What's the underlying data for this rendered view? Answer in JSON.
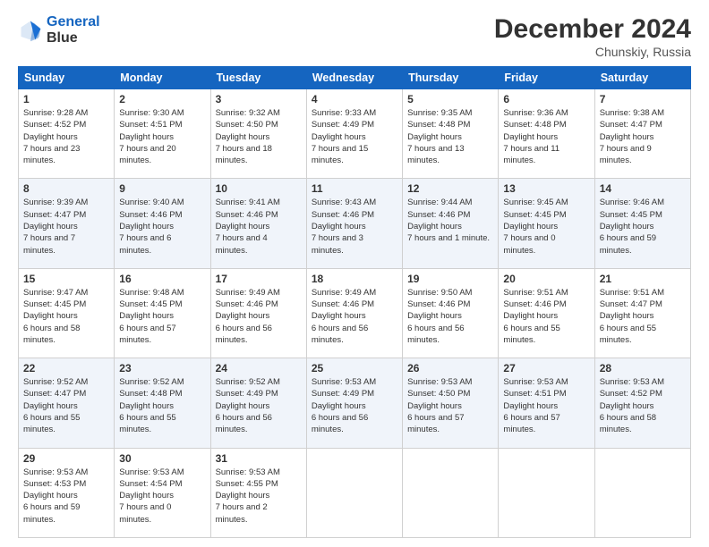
{
  "header": {
    "logo_line1": "General",
    "logo_line2": "Blue",
    "main_title": "December 2024",
    "subtitle": "Chunskiy, Russia"
  },
  "days_of_week": [
    "Sunday",
    "Monday",
    "Tuesday",
    "Wednesday",
    "Thursday",
    "Friday",
    "Saturday"
  ],
  "weeks": [
    [
      {
        "day": "1",
        "sunrise": "9:28 AM",
        "sunset": "4:52 PM",
        "daylight": "7 hours and 23 minutes."
      },
      {
        "day": "2",
        "sunrise": "9:30 AM",
        "sunset": "4:51 PM",
        "daylight": "7 hours and 20 minutes."
      },
      {
        "day": "3",
        "sunrise": "9:32 AM",
        "sunset": "4:50 PM",
        "daylight": "7 hours and 18 minutes."
      },
      {
        "day": "4",
        "sunrise": "9:33 AM",
        "sunset": "4:49 PM",
        "daylight": "7 hours and 15 minutes."
      },
      {
        "day": "5",
        "sunrise": "9:35 AM",
        "sunset": "4:48 PM",
        "daylight": "7 hours and 13 minutes."
      },
      {
        "day": "6",
        "sunrise": "9:36 AM",
        "sunset": "4:48 PM",
        "daylight": "7 hours and 11 minutes."
      },
      {
        "day": "7",
        "sunrise": "9:38 AM",
        "sunset": "4:47 PM",
        "daylight": "7 hours and 9 minutes."
      }
    ],
    [
      {
        "day": "8",
        "sunrise": "9:39 AM",
        "sunset": "4:47 PM",
        "daylight": "7 hours and 7 minutes."
      },
      {
        "day": "9",
        "sunrise": "9:40 AM",
        "sunset": "4:46 PM",
        "daylight": "7 hours and 6 minutes."
      },
      {
        "day": "10",
        "sunrise": "9:41 AM",
        "sunset": "4:46 PM",
        "daylight": "7 hours and 4 minutes."
      },
      {
        "day": "11",
        "sunrise": "9:43 AM",
        "sunset": "4:46 PM",
        "daylight": "7 hours and 3 minutes."
      },
      {
        "day": "12",
        "sunrise": "9:44 AM",
        "sunset": "4:46 PM",
        "daylight": "7 hours and 1 minute."
      },
      {
        "day": "13",
        "sunrise": "9:45 AM",
        "sunset": "4:45 PM",
        "daylight": "7 hours and 0 minutes."
      },
      {
        "day": "14",
        "sunrise": "9:46 AM",
        "sunset": "4:45 PM",
        "daylight": "6 hours and 59 minutes."
      }
    ],
    [
      {
        "day": "15",
        "sunrise": "9:47 AM",
        "sunset": "4:45 PM",
        "daylight": "6 hours and 58 minutes."
      },
      {
        "day": "16",
        "sunrise": "9:48 AM",
        "sunset": "4:45 PM",
        "daylight": "6 hours and 57 minutes."
      },
      {
        "day": "17",
        "sunrise": "9:49 AM",
        "sunset": "4:46 PM",
        "daylight": "6 hours and 56 minutes."
      },
      {
        "day": "18",
        "sunrise": "9:49 AM",
        "sunset": "4:46 PM",
        "daylight": "6 hours and 56 minutes."
      },
      {
        "day": "19",
        "sunrise": "9:50 AM",
        "sunset": "4:46 PM",
        "daylight": "6 hours and 56 minutes."
      },
      {
        "day": "20",
        "sunrise": "9:51 AM",
        "sunset": "4:46 PM",
        "daylight": "6 hours and 55 minutes."
      },
      {
        "day": "21",
        "sunrise": "9:51 AM",
        "sunset": "4:47 PM",
        "daylight": "6 hours and 55 minutes."
      }
    ],
    [
      {
        "day": "22",
        "sunrise": "9:52 AM",
        "sunset": "4:47 PM",
        "daylight": "6 hours and 55 minutes."
      },
      {
        "day": "23",
        "sunrise": "9:52 AM",
        "sunset": "4:48 PM",
        "daylight": "6 hours and 55 minutes."
      },
      {
        "day": "24",
        "sunrise": "9:52 AM",
        "sunset": "4:49 PM",
        "daylight": "6 hours and 56 minutes."
      },
      {
        "day": "25",
        "sunrise": "9:53 AM",
        "sunset": "4:49 PM",
        "daylight": "6 hours and 56 minutes."
      },
      {
        "day": "26",
        "sunrise": "9:53 AM",
        "sunset": "4:50 PM",
        "daylight": "6 hours and 57 minutes."
      },
      {
        "day": "27",
        "sunrise": "9:53 AM",
        "sunset": "4:51 PM",
        "daylight": "6 hours and 57 minutes."
      },
      {
        "day": "28",
        "sunrise": "9:53 AM",
        "sunset": "4:52 PM",
        "daylight": "6 hours and 58 minutes."
      }
    ],
    [
      {
        "day": "29",
        "sunrise": "9:53 AM",
        "sunset": "4:53 PM",
        "daylight": "6 hours and 59 minutes."
      },
      {
        "day": "30",
        "sunrise": "9:53 AM",
        "sunset": "4:54 PM",
        "daylight": "7 hours and 0 minutes."
      },
      {
        "day": "31",
        "sunrise": "9:53 AM",
        "sunset": "4:55 PM",
        "daylight": "7 hours and 2 minutes."
      },
      null,
      null,
      null,
      null
    ]
  ]
}
